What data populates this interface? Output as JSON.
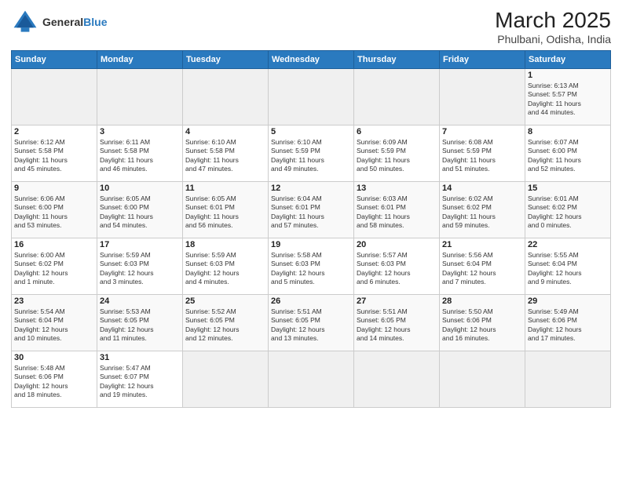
{
  "logo": {
    "line1": "General",
    "line2": "Blue"
  },
  "title": "March 2025",
  "subtitle": "Phulbani, Odisha, India",
  "weekdays": [
    "Sunday",
    "Monday",
    "Tuesday",
    "Wednesday",
    "Thursday",
    "Friday",
    "Saturday"
  ],
  "weeks": [
    [
      {
        "day": "",
        "info": ""
      },
      {
        "day": "",
        "info": ""
      },
      {
        "day": "",
        "info": ""
      },
      {
        "day": "",
        "info": ""
      },
      {
        "day": "",
        "info": ""
      },
      {
        "day": "",
        "info": ""
      },
      {
        "day": "1",
        "info": "Sunrise: 6:13 AM\nSunset: 5:57 PM\nDaylight: 11 hours\nand 44 minutes."
      }
    ],
    [
      {
        "day": "2",
        "info": "Sunrise: 6:12 AM\nSunset: 5:58 PM\nDaylight: 11 hours\nand 45 minutes."
      },
      {
        "day": "3",
        "info": "Sunrise: 6:11 AM\nSunset: 5:58 PM\nDaylight: 11 hours\nand 46 minutes."
      },
      {
        "day": "4",
        "info": "Sunrise: 6:10 AM\nSunset: 5:58 PM\nDaylight: 11 hours\nand 47 minutes."
      },
      {
        "day": "5",
        "info": "Sunrise: 6:10 AM\nSunset: 5:59 PM\nDaylight: 11 hours\nand 49 minutes."
      },
      {
        "day": "6",
        "info": "Sunrise: 6:09 AM\nSunset: 5:59 PM\nDaylight: 11 hours\nand 50 minutes."
      },
      {
        "day": "7",
        "info": "Sunrise: 6:08 AM\nSunset: 5:59 PM\nDaylight: 11 hours\nand 51 minutes."
      },
      {
        "day": "8",
        "info": "Sunrise: 6:07 AM\nSunset: 6:00 PM\nDaylight: 11 hours\nand 52 minutes."
      }
    ],
    [
      {
        "day": "9",
        "info": "Sunrise: 6:06 AM\nSunset: 6:00 PM\nDaylight: 11 hours\nand 53 minutes."
      },
      {
        "day": "10",
        "info": "Sunrise: 6:05 AM\nSunset: 6:00 PM\nDaylight: 11 hours\nand 54 minutes."
      },
      {
        "day": "11",
        "info": "Sunrise: 6:05 AM\nSunset: 6:01 PM\nDaylight: 11 hours\nand 56 minutes."
      },
      {
        "day": "12",
        "info": "Sunrise: 6:04 AM\nSunset: 6:01 PM\nDaylight: 11 hours\nand 57 minutes."
      },
      {
        "day": "13",
        "info": "Sunrise: 6:03 AM\nSunset: 6:01 PM\nDaylight: 11 hours\nand 58 minutes."
      },
      {
        "day": "14",
        "info": "Sunrise: 6:02 AM\nSunset: 6:02 PM\nDaylight: 11 hours\nand 59 minutes."
      },
      {
        "day": "15",
        "info": "Sunrise: 6:01 AM\nSunset: 6:02 PM\nDaylight: 12 hours\nand 0 minutes."
      }
    ],
    [
      {
        "day": "16",
        "info": "Sunrise: 6:00 AM\nSunset: 6:02 PM\nDaylight: 12 hours\nand 1 minute."
      },
      {
        "day": "17",
        "info": "Sunrise: 5:59 AM\nSunset: 6:03 PM\nDaylight: 12 hours\nand 3 minutes."
      },
      {
        "day": "18",
        "info": "Sunrise: 5:59 AM\nSunset: 6:03 PM\nDaylight: 12 hours\nand 4 minutes."
      },
      {
        "day": "19",
        "info": "Sunrise: 5:58 AM\nSunset: 6:03 PM\nDaylight: 12 hours\nand 5 minutes."
      },
      {
        "day": "20",
        "info": "Sunrise: 5:57 AM\nSunset: 6:03 PM\nDaylight: 12 hours\nand 6 minutes."
      },
      {
        "day": "21",
        "info": "Sunrise: 5:56 AM\nSunset: 6:04 PM\nDaylight: 12 hours\nand 7 minutes."
      },
      {
        "day": "22",
        "info": "Sunrise: 5:55 AM\nSunset: 6:04 PM\nDaylight: 12 hours\nand 9 minutes."
      }
    ],
    [
      {
        "day": "23",
        "info": "Sunrise: 5:54 AM\nSunset: 6:04 PM\nDaylight: 12 hours\nand 10 minutes."
      },
      {
        "day": "24",
        "info": "Sunrise: 5:53 AM\nSunset: 6:05 PM\nDaylight: 12 hours\nand 11 minutes."
      },
      {
        "day": "25",
        "info": "Sunrise: 5:52 AM\nSunset: 6:05 PM\nDaylight: 12 hours\nand 12 minutes."
      },
      {
        "day": "26",
        "info": "Sunrise: 5:51 AM\nSunset: 6:05 PM\nDaylight: 12 hours\nand 13 minutes."
      },
      {
        "day": "27",
        "info": "Sunrise: 5:51 AM\nSunset: 6:05 PM\nDaylight: 12 hours\nand 14 minutes."
      },
      {
        "day": "28",
        "info": "Sunrise: 5:50 AM\nSunset: 6:06 PM\nDaylight: 12 hours\nand 16 minutes."
      },
      {
        "day": "29",
        "info": "Sunrise: 5:49 AM\nSunset: 6:06 PM\nDaylight: 12 hours\nand 17 minutes."
      }
    ],
    [
      {
        "day": "30",
        "info": "Sunrise: 5:48 AM\nSunset: 6:06 PM\nDaylight: 12 hours\nand 18 minutes."
      },
      {
        "day": "31",
        "info": "Sunrise: 5:47 AM\nSunset: 6:07 PM\nDaylight: 12 hours\nand 19 minutes."
      },
      {
        "day": "",
        "info": ""
      },
      {
        "day": "",
        "info": ""
      },
      {
        "day": "",
        "info": ""
      },
      {
        "day": "",
        "info": ""
      },
      {
        "day": "",
        "info": ""
      }
    ]
  ]
}
